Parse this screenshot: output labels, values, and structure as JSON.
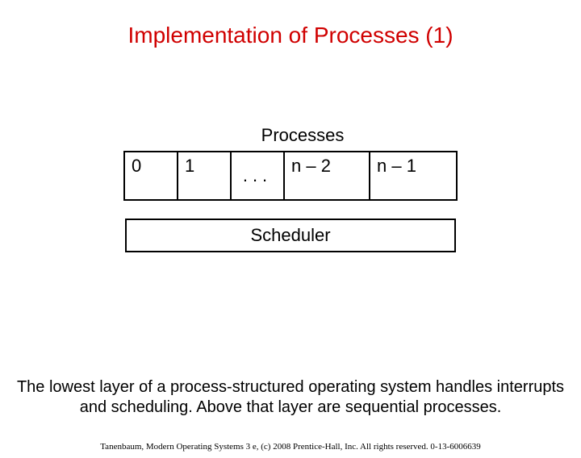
{
  "title": "Implementation of Processes (1)",
  "figure": {
    "label": "Processes",
    "cells": {
      "c0": "0",
      "c1": "1",
      "dots": "...",
      "c_n2": "n – 2",
      "c_n1": "n – 1"
    },
    "scheduler": "Scheduler"
  },
  "caption": "The lowest layer of a process-structured operating system handles interrupts and scheduling. Above that layer are sequential processes.",
  "citation": "Tanenbaum, Modern Operating Systems 3 e, (c) 2008 Prentice-Hall, Inc. All rights reserved. 0-13-6006639"
}
